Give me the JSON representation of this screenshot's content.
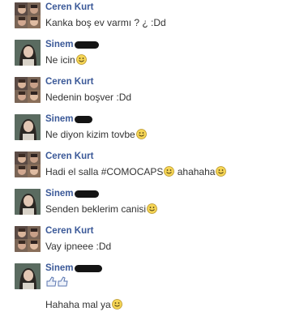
{
  "people": {
    "ceren": {
      "name": "Ceren Kurt"
    },
    "sinem": {
      "name": "Sinem"
    }
  },
  "messages": [
    {
      "sender": "ceren",
      "text": "Kanka boş ev varmı ? ¿ :Dd",
      "emoji": false
    },
    {
      "sender": "sinem",
      "text": "Ne icin",
      "emoji": true
    },
    {
      "sender": "ceren",
      "text": "Nedenin boşver :Dd",
      "emoji": false
    },
    {
      "sender": "sinem",
      "text": "Ne diyon kizim tovbe",
      "emoji": true
    },
    {
      "sender": "ceren",
      "text": "Hadi el salla #COMOCAPS",
      "emoji": true,
      "text_after": "ahahaha",
      "emoji_after": true
    },
    {
      "sender": "sinem",
      "text": "Senden beklerim canisi",
      "emoji": true
    },
    {
      "sender": "ceren",
      "text": "Vay ipneee :Dd",
      "emoji": false
    },
    {
      "sender": "sinem",
      "text": "",
      "emoji": false,
      "sticker": "thumbs-icon"
    },
    {
      "sender": "sinem",
      "text": "Hahaha mal ya",
      "emoji": true
    }
  ],
  "colors": {
    "name": "#3b5998",
    "text": "#333333",
    "emoji": "#f5d556"
  }
}
